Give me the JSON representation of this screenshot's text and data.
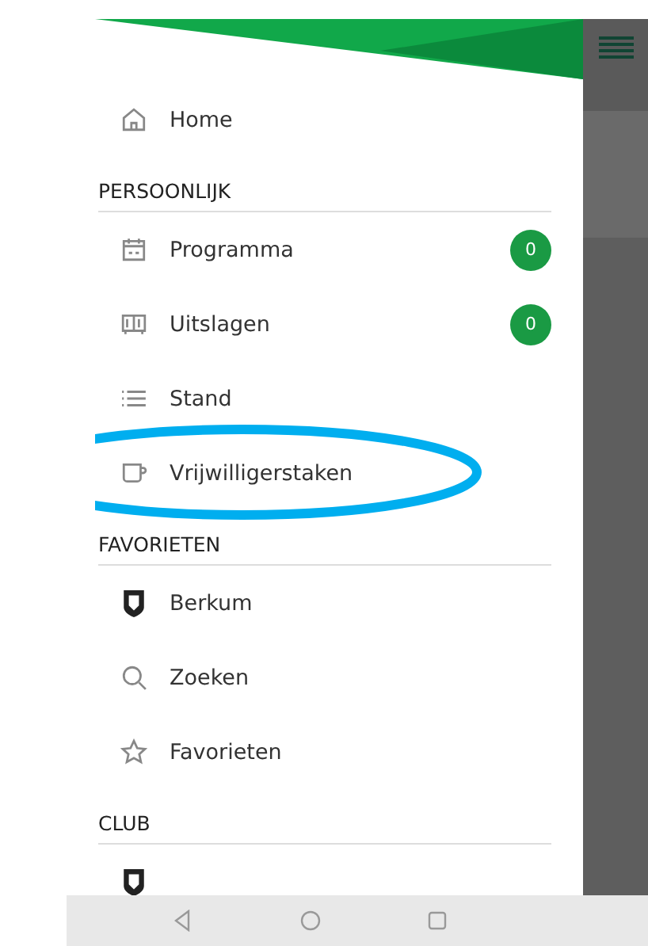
{
  "drawer": {
    "sections": [
      {
        "items": [
          {
            "kind": "home",
            "label": "Home"
          }
        ]
      },
      {
        "header": "PERSOONLIJK",
        "items": [
          {
            "kind": "calendar",
            "label": "Programma",
            "badge": "0"
          },
          {
            "kind": "results",
            "label": "Uitslagen",
            "badge": "0"
          },
          {
            "kind": "list",
            "label": "Stand"
          },
          {
            "kind": "cup",
            "label": "Vrijwilligerstaken",
            "highlighted": true
          }
        ]
      },
      {
        "header": "FAVORIETEN",
        "items": [
          {
            "kind": "crest",
            "label": "Berkum"
          },
          {
            "kind": "search",
            "label": "Zoeken"
          },
          {
            "kind": "star",
            "label": "Favorieten"
          }
        ]
      },
      {
        "header": "CLUB",
        "items": [
          {
            "kind": "crest"
          }
        ]
      }
    ]
  }
}
